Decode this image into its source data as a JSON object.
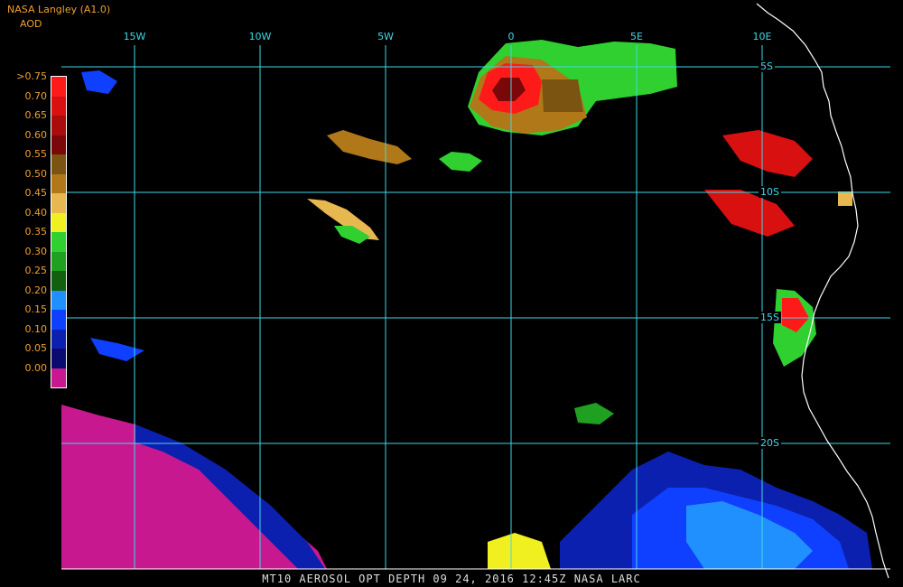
{
  "header": {
    "producer": "NASA Langley (A1.0)",
    "product": "AOD"
  },
  "legend": [
    {
      "label": ">0.75",
      "color": "#ff1a1a"
    },
    {
      "label": "0.70",
      "color": "#d81010"
    },
    {
      "label": "0.65",
      "color": "#a80c0c"
    },
    {
      "label": "0.60",
      "color": "#7a0808"
    },
    {
      "label": "0.55",
      "color": "#7a5410"
    },
    {
      "label": "0.50",
      "color": "#b07818"
    },
    {
      "label": "0.45",
      "color": "#e8b850"
    },
    {
      "label": "0.40",
      "color": "#f0f020"
    },
    {
      "label": "0.35",
      "color": "#30d030"
    },
    {
      "label": "0.30",
      "color": "#20a020"
    },
    {
      "label": "0.25",
      "color": "#106010"
    },
    {
      "label": "0.20",
      "color": "#2090ff"
    },
    {
      "label": "0.15",
      "color": "#1040ff"
    },
    {
      "label": "0.10",
      "color": "#0c20b0"
    },
    {
      "label": "0.05",
      "color": "#0a0a70"
    },
    {
      "label": "0.00",
      "color": "#c81890"
    }
  ],
  "lon_labels": [
    {
      "label": "15W",
      "lon": -15
    },
    {
      "label": "10W",
      "lon": -10
    },
    {
      "label": "5W",
      "lon": -5
    },
    {
      "label": "0",
      "lon": 0
    },
    {
      "label": "5E",
      "lon": 5
    },
    {
      "label": "10E",
      "lon": 10
    }
  ],
  "lat_labels": [
    {
      "label": "5S",
      "lat": -5
    },
    {
      "label": "10S",
      "lat": -10
    },
    {
      "label": "15S",
      "lat": -15
    },
    {
      "label": "20S",
      "lat": -20
    }
  ],
  "footer": "MT10  AEROSOL OPT DEPTH   09 24, 2016 12:45Z  NASA LARC",
  "colors": {
    "grid": "#3fd8e8",
    "coast": "#ffffff",
    "text": "#f0a030"
  }
}
